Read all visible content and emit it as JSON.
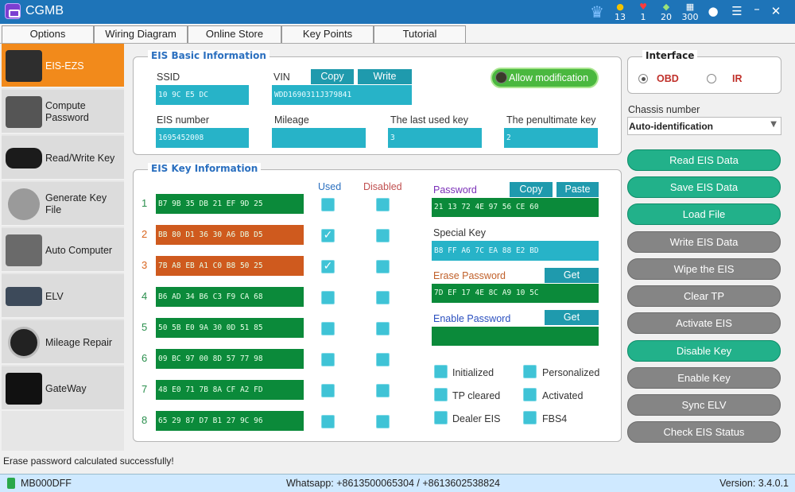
{
  "app": {
    "title": "CGMB"
  },
  "titlebar": {
    "stats": [
      {
        "icon": "coin-icon",
        "glyph": "●",
        "color": "#f2c200",
        "value": "13"
      },
      {
        "icon": "heart-icon",
        "glyph": "♥",
        "color": "#ff3b3b",
        "value": "1"
      },
      {
        "icon": "gem-icon",
        "glyph": "◆",
        "color": "#9be27a",
        "value": "20"
      },
      {
        "icon": "barcode-icon",
        "glyph": "▦",
        "color": "#ffffff",
        "value": "300"
      }
    ]
  },
  "menu": [
    "Options",
    "Wiring Diagram",
    "Online Store",
    "Key Points",
    "Tutorial"
  ],
  "sidebar": [
    {
      "label": "EIS-EZS",
      "active": true
    },
    {
      "label": "Compute Password"
    },
    {
      "label": "Read/Write Key"
    },
    {
      "label": "Generate Key File"
    },
    {
      "label": "Auto Computer"
    },
    {
      "label": "ELV"
    },
    {
      "label": "Mileage Repair"
    },
    {
      "label": "GateWay"
    }
  ],
  "basic": {
    "title": "EIS Basic Information",
    "ssid_label": "SSID",
    "ssid": "10 9C E5 DC",
    "vin_label": "VIN",
    "vin": "WDD1690311J379841",
    "copy": "Copy",
    "write": "Write",
    "allow": "Allow modification",
    "eisnum_label": "EIS number",
    "eisnum": "1695452008",
    "mileage_label": "Mileage",
    "mileage": "",
    "lastkey_label": "The last used key",
    "lastkey": "3",
    "penkey_label": "The penultimate key",
    "penkey": "2"
  },
  "keys": {
    "title": "EIS Key Information",
    "used": "Used",
    "disabled": "Disabled",
    "rows": [
      {
        "n": "1",
        "hex": "B7 9B 35 DB 21 EF 9D 25",
        "used": false,
        "state": "ok"
      },
      {
        "n": "2",
        "hex": "BB 80 D1 36 30 A6 DB D5",
        "used": true,
        "state": "used"
      },
      {
        "n": "3",
        "hex": "7B A8 EB A1 C0 B8 50 25",
        "used": true,
        "state": "used"
      },
      {
        "n": "4",
        "hex": "B6 AD 34 B6 C3 F9 CA 68",
        "used": false,
        "state": "ok"
      },
      {
        "n": "5",
        "hex": "50 5B E0 9A 30 0D 51 85",
        "used": false,
        "state": "ok"
      },
      {
        "n": "6",
        "hex": "09 BC 97 00 8D 57 77 98",
        "used": false,
        "state": "ok"
      },
      {
        "n": "7",
        "hex": "48 E0 71 7B 8A CF A2 FD",
        "used": false,
        "state": "ok"
      },
      {
        "n": "8",
        "hex": "65 29 87 D7 B1 27 9C 96",
        "used": false,
        "state": "ok"
      }
    ],
    "password_label": "Password",
    "password": "21 13 72 4E 97 56 CE 60",
    "copy": "Copy",
    "paste": "Paste",
    "special_label": "Special Key",
    "special": "B8 FF A6 7C EA 88 E2 BD",
    "erase_label": "Erase Password",
    "erase": "7D EF 17 4E 8C A9 10 5C",
    "enable_label": "Enable Password",
    "enable": "",
    "get": "Get",
    "flags": [
      "Initialized",
      "Personalized",
      "TP cleared",
      "Activated",
      "Dealer EIS",
      "FBS4"
    ]
  },
  "interface": {
    "title": "Interface",
    "obd": "OBD",
    "ir": "IR"
  },
  "chassis": {
    "label": "Chassis number",
    "value": "Auto-identification"
  },
  "actions": [
    {
      "label": "Read EIS Data",
      "style": "green"
    },
    {
      "label": "Save EIS Data",
      "style": "green"
    },
    {
      "label": "Load File",
      "style": "green"
    },
    {
      "label": "Write EIS Data",
      "style": "grey"
    },
    {
      "label": "Wipe the EIS",
      "style": "grey"
    },
    {
      "label": "Clear TP",
      "style": "grey"
    },
    {
      "label": "Activate EIS",
      "style": "grey"
    },
    {
      "label": "Disable Key",
      "style": "green"
    },
    {
      "label": "Enable Key",
      "style": "grey"
    },
    {
      "label": "Sync ELV",
      "style": "grey"
    },
    {
      "label": "Check EIS Status",
      "style": "grey"
    }
  ],
  "status": "Erase password calculated successfully!",
  "footer": {
    "device": "MB000DFF",
    "contact": "Whatsapp: +8613500065304 / +8613602538824",
    "version": "Version: 3.4.0.1"
  }
}
